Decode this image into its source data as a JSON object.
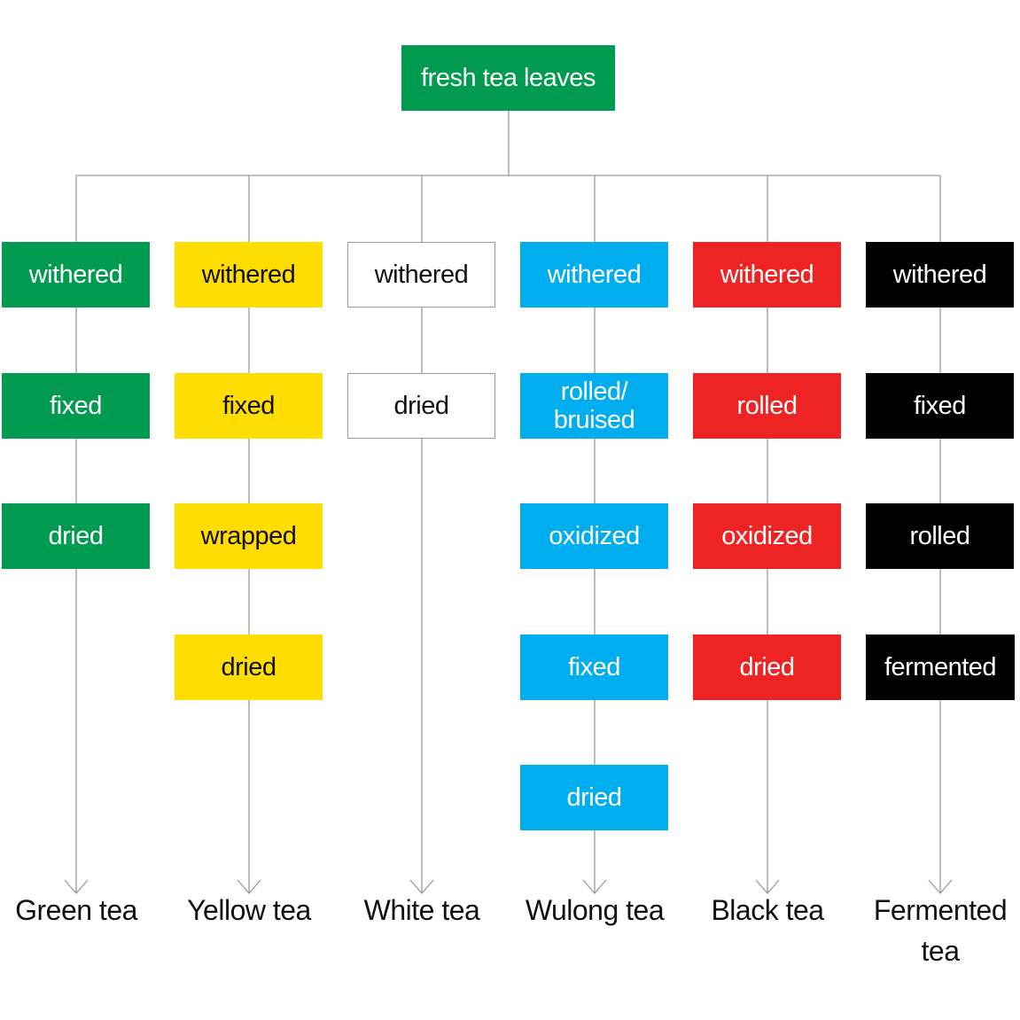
{
  "diagram": {
    "root": {
      "label": "fresh tea leaves",
      "color": "#009b4e",
      "text_color": "#ffffff"
    },
    "columns": [
      {
        "name": "Green tea",
        "color": "#009b4e",
        "text_color": "#ffffff",
        "border": "#009b4e",
        "steps": [
          "withered",
          "fixed",
          "dried"
        ]
      },
      {
        "name": "Yellow tea",
        "color": "#ffdd00",
        "text_color": "#111111",
        "border": "#ffdd00",
        "steps": [
          "withered",
          "fixed",
          "wrapped",
          "dried"
        ]
      },
      {
        "name": "White tea",
        "color": "#ffffff",
        "text_color": "#111111",
        "border": "#9a9a9a",
        "steps": [
          "withered",
          "dried"
        ]
      },
      {
        "name": "Wulong tea",
        "color": "#00adef",
        "text_color": "#ffffff",
        "border": "#00adef",
        "steps": [
          "withered",
          "rolled/ bruised",
          "oxidized",
          "fixed",
          "dried"
        ]
      },
      {
        "name": "Black tea",
        "color": "#ee2424",
        "text_color": "#ffffff",
        "border": "#ee2424",
        "steps": [
          "withered",
          "rolled",
          "oxidized",
          "dried"
        ]
      },
      {
        "name": "Fermented tea",
        "color": "#000000",
        "text_color": "#ffffff",
        "border": "#000000",
        "steps": [
          "withered",
          "fixed",
          "rolled",
          "fermented"
        ]
      }
    ],
    "line_color": "#9a9a9a"
  }
}
